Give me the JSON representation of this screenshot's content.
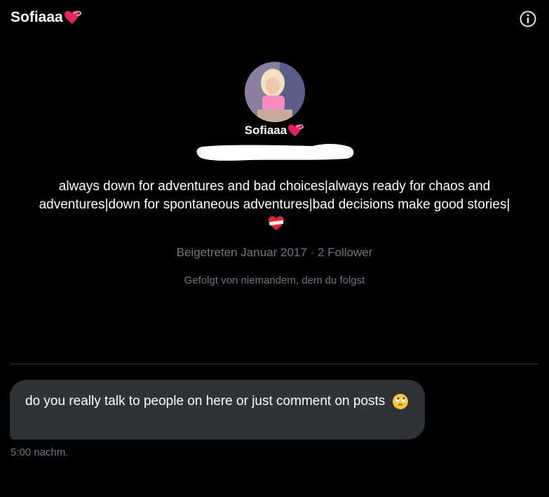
{
  "header": {
    "title": "Sofiaaa",
    "title_emoji": "heart-with-ribbon",
    "info_icon": "info-circle-icon"
  },
  "profile": {
    "name": "Sofiaaa",
    "name_emoji": "heart-with-ribbon",
    "bio": "always down for adventures and bad choices|always ready for chaos and adventures|down for spontaneous adventures|bad decisions make good stories|",
    "bio_emoji": "mending-heart",
    "meta": "Beigetreten Januar 2017 · 2 Follower",
    "followed_by": "Gefolgt von niemandem, dem du folgst"
  },
  "message": {
    "text": "do you really talk to people on here or just comment on posts",
    "emoji": "face-with-rolling-eyes",
    "timestamp": "5:00 nachm."
  },
  "colors": {
    "background": "#000000",
    "bubble": "#2f3336",
    "muted": "#71767b",
    "accent_heart": "#e0245e"
  }
}
